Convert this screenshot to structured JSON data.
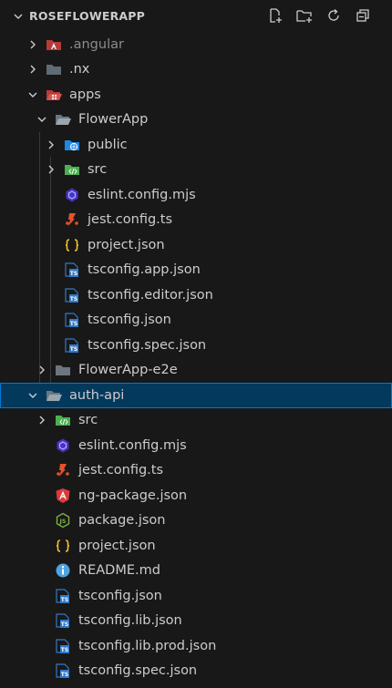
{
  "explorer": {
    "project_title": "ROSEFLOWERAPP"
  },
  "header_actions": [
    "new-file-icon",
    "new-folder-icon",
    "refresh-icon",
    "collapse-all-icon"
  ],
  "tree": [
    {
      "label": ".angular",
      "dim": true
    },
    {
      "label": ".nx",
      "dim": false
    },
    {
      "label": "apps"
    },
    {
      "label": "FlowerApp"
    },
    {
      "label": "public"
    },
    {
      "label": "src"
    },
    {
      "label": "eslint.config.mjs"
    },
    {
      "label": "jest.config.ts"
    },
    {
      "label": "project.json"
    },
    {
      "label": "tsconfig.app.json"
    },
    {
      "label": "tsconfig.editor.json"
    },
    {
      "label": "tsconfig.json"
    },
    {
      "label": "tsconfig.spec.json"
    },
    {
      "label": "FlowerApp-e2e"
    },
    {
      "label": "auth-api"
    },
    {
      "label": "src"
    },
    {
      "label": "eslint.config.mjs"
    },
    {
      "label": "jest.config.ts"
    },
    {
      "label": "ng-package.json"
    },
    {
      "label": "package.json"
    },
    {
      "label": "project.json"
    },
    {
      "label": "README.md"
    },
    {
      "label": "tsconfig.json"
    },
    {
      "label": "tsconfig.lib.json"
    },
    {
      "label": "tsconfig.lib.prod.json"
    },
    {
      "label": "tsconfig.spec.json"
    }
  ],
  "colors": {
    "background": "#181818",
    "selection": "#04395e",
    "selection_border": "#0078d4",
    "text": "#cccccc",
    "ts_icon": "#3178c6",
    "json_icon": "#f1c232",
    "jest_icon": "#e5522c",
    "eslint_icon": "#6c6fdd",
    "angular_icon": "#dd3b3b",
    "node_icon": "#7cb342",
    "info_icon": "#4fa3e0"
  }
}
